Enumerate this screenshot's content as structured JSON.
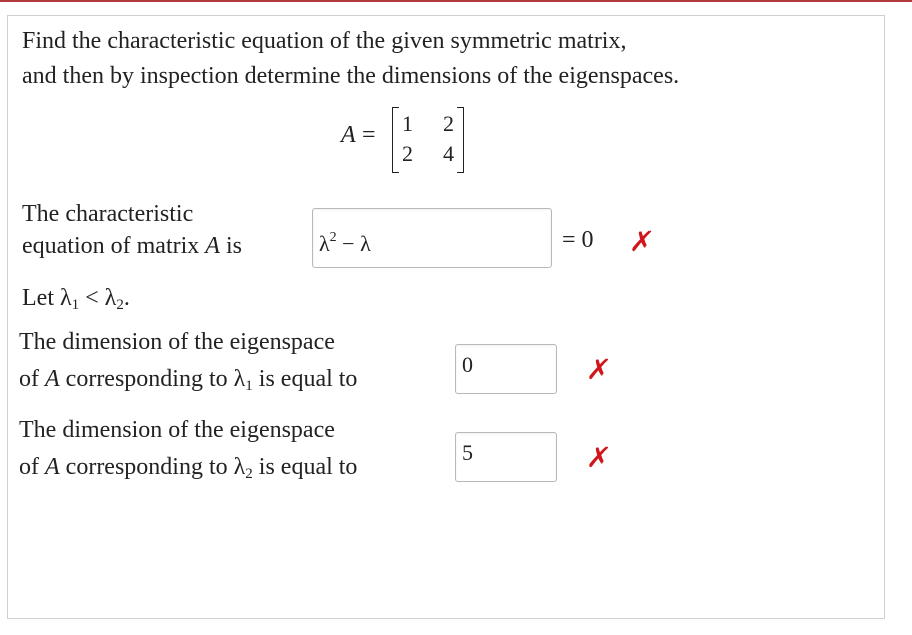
{
  "question": {
    "line1": "Find the characteristic equation of the given symmetric matrix,",
    "line2": "and then by inspection determine the dimensions of the eigenspaces."
  },
  "matrix": {
    "label": "A",
    "equals": "=",
    "rows": [
      [
        "1",
        "2"
      ],
      [
        "2",
        "4"
      ]
    ]
  },
  "char_eq": {
    "label_line1": "The characteristic",
    "label_line2_prefix": "equation of matrix ",
    "label_var": "A",
    "label_line2_suffix": " is",
    "input_lambda1": "λ",
    "input_sup": "2",
    "input_rest": " − λ",
    "equals_zero": "= 0",
    "status_icon": "✗",
    "status": "incorrect"
  },
  "let_statement": {
    "prefix": "Let ",
    "lambda": "λ",
    "sub1": "1",
    "lt": " < ",
    "sub2": "2",
    "suffix": "."
  },
  "dim1": {
    "line1": "The dimension of the eigenspace",
    "line2_prefix": "of ",
    "var": "A",
    "line2_mid": " corresponding to ",
    "lambda": "λ",
    "sub": "1",
    "line2_suffix": " is equal to",
    "value": "0",
    "status_icon": "✗",
    "status": "incorrect"
  },
  "dim2": {
    "line1": "The dimension of the eigenspace",
    "line2_prefix": "of ",
    "var": "A",
    "line2_mid": " corresponding to ",
    "lambda": "λ",
    "sub": "2",
    "line2_suffix": " is equal to",
    "value": "5",
    "status_icon": "✗",
    "status": "incorrect"
  },
  "colors": {
    "incorrect": "#d0151b",
    "top_bar": "#b03a3e"
  }
}
